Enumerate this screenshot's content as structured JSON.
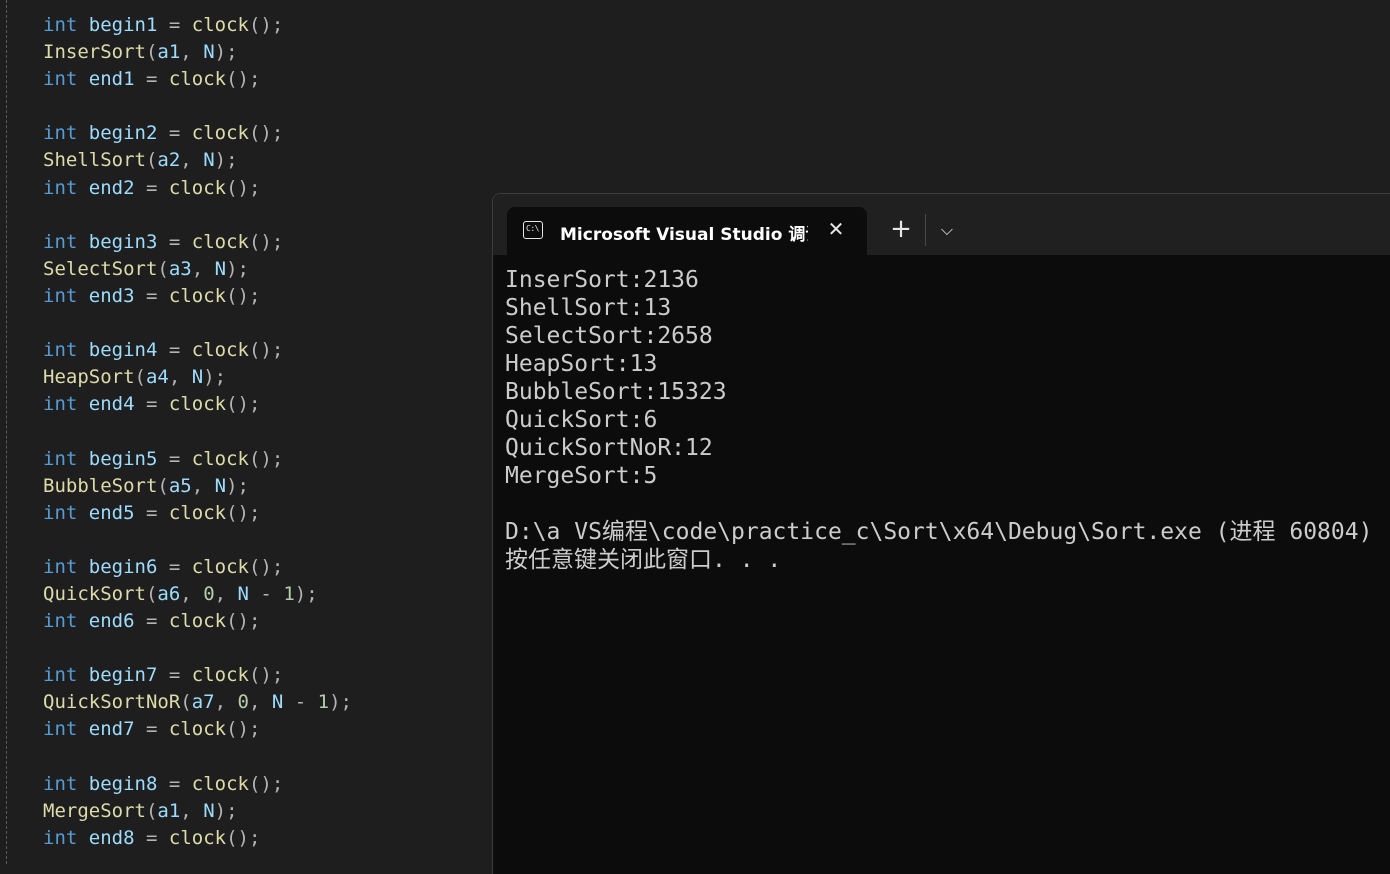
{
  "editor": {
    "lines": [
      {
        "parts": [
          [
            "kw",
            "int"
          ],
          [
            "pun",
            " "
          ],
          [
            "var",
            "begin1"
          ],
          [
            "op",
            " = "
          ],
          [
            "fn",
            "clock"
          ],
          [
            "pun",
            "();"
          ]
        ]
      },
      {
        "parts": [
          [
            "fn",
            "InserSort"
          ],
          [
            "pun",
            "("
          ],
          [
            "var",
            "a1"
          ],
          [
            "pun",
            ", "
          ],
          [
            "var",
            "N"
          ],
          [
            "pun",
            ");"
          ]
        ]
      },
      {
        "parts": [
          [
            "kw",
            "int"
          ],
          [
            "pun",
            " "
          ],
          [
            "var",
            "end1"
          ],
          [
            "op",
            " = "
          ],
          [
            "fn",
            "clock"
          ],
          [
            "pun",
            "();"
          ]
        ]
      },
      {
        "parts": []
      },
      {
        "parts": [
          [
            "kw",
            "int"
          ],
          [
            "pun",
            " "
          ],
          [
            "var",
            "begin2"
          ],
          [
            "op",
            " = "
          ],
          [
            "fn",
            "clock"
          ],
          [
            "pun",
            "();"
          ]
        ]
      },
      {
        "parts": [
          [
            "fn",
            "ShellSort"
          ],
          [
            "pun",
            "("
          ],
          [
            "var",
            "a2"
          ],
          [
            "pun",
            ", "
          ],
          [
            "var",
            "N"
          ],
          [
            "pun",
            ");"
          ]
        ]
      },
      {
        "parts": [
          [
            "kw",
            "int"
          ],
          [
            "pun",
            " "
          ],
          [
            "var",
            "end2"
          ],
          [
            "op",
            " = "
          ],
          [
            "fn",
            "clock"
          ],
          [
            "pun",
            "();"
          ]
        ]
      },
      {
        "parts": []
      },
      {
        "parts": [
          [
            "kw",
            "int"
          ],
          [
            "pun",
            " "
          ],
          [
            "var",
            "begin3"
          ],
          [
            "op",
            " = "
          ],
          [
            "fn",
            "clock"
          ],
          [
            "pun",
            "();"
          ]
        ]
      },
      {
        "parts": [
          [
            "fn",
            "SelectSort"
          ],
          [
            "pun",
            "("
          ],
          [
            "var",
            "a3"
          ],
          [
            "pun",
            ", "
          ],
          [
            "var",
            "N"
          ],
          [
            "pun",
            ");"
          ]
        ]
      },
      {
        "parts": [
          [
            "kw",
            "int"
          ],
          [
            "pun",
            " "
          ],
          [
            "var",
            "end3"
          ],
          [
            "op",
            " = "
          ],
          [
            "fn",
            "clock"
          ],
          [
            "pun",
            "();"
          ]
        ]
      },
      {
        "parts": []
      },
      {
        "parts": [
          [
            "kw",
            "int"
          ],
          [
            "pun",
            " "
          ],
          [
            "var",
            "begin4"
          ],
          [
            "op",
            " = "
          ],
          [
            "fn",
            "clock"
          ],
          [
            "pun",
            "();"
          ]
        ]
      },
      {
        "parts": [
          [
            "fn",
            "HeapSort"
          ],
          [
            "pun",
            "("
          ],
          [
            "var",
            "a4"
          ],
          [
            "pun",
            ", "
          ],
          [
            "var",
            "N"
          ],
          [
            "pun",
            ");"
          ]
        ]
      },
      {
        "parts": [
          [
            "kw",
            "int"
          ],
          [
            "pun",
            " "
          ],
          [
            "var",
            "end4"
          ],
          [
            "op",
            " = "
          ],
          [
            "fn",
            "clock"
          ],
          [
            "pun",
            "();"
          ]
        ]
      },
      {
        "parts": []
      },
      {
        "parts": [
          [
            "kw",
            "int"
          ],
          [
            "pun",
            " "
          ],
          [
            "var",
            "begin5"
          ],
          [
            "op",
            " = "
          ],
          [
            "fn",
            "clock"
          ],
          [
            "pun",
            "();"
          ]
        ]
      },
      {
        "parts": [
          [
            "fn",
            "BubbleSort"
          ],
          [
            "pun",
            "("
          ],
          [
            "var",
            "a5"
          ],
          [
            "pun",
            ", "
          ],
          [
            "var",
            "N"
          ],
          [
            "pun",
            ");"
          ]
        ]
      },
      {
        "parts": [
          [
            "kw",
            "int"
          ],
          [
            "pun",
            " "
          ],
          [
            "var",
            "end5"
          ],
          [
            "op",
            " = "
          ],
          [
            "fn",
            "clock"
          ],
          [
            "pun",
            "();"
          ]
        ]
      },
      {
        "parts": []
      },
      {
        "parts": [
          [
            "kw",
            "int"
          ],
          [
            "pun",
            " "
          ],
          [
            "var",
            "begin6"
          ],
          [
            "op",
            " = "
          ],
          [
            "fn",
            "clock"
          ],
          [
            "pun",
            "();"
          ]
        ]
      },
      {
        "parts": [
          [
            "fn",
            "QuickSort"
          ],
          [
            "pun",
            "("
          ],
          [
            "var",
            "a6"
          ],
          [
            "pun",
            ", "
          ],
          [
            "num",
            "0"
          ],
          [
            "pun",
            ", "
          ],
          [
            "var",
            "N"
          ],
          [
            "op",
            " - "
          ],
          [
            "num",
            "1"
          ],
          [
            "pun",
            ");"
          ]
        ]
      },
      {
        "parts": [
          [
            "kw",
            "int"
          ],
          [
            "pun",
            " "
          ],
          [
            "var",
            "end6"
          ],
          [
            "op",
            " = "
          ],
          [
            "fn",
            "clock"
          ],
          [
            "pun",
            "();"
          ]
        ]
      },
      {
        "parts": []
      },
      {
        "parts": [
          [
            "kw",
            "int"
          ],
          [
            "pun",
            " "
          ],
          [
            "var",
            "begin7"
          ],
          [
            "op",
            " = "
          ],
          [
            "fn",
            "clock"
          ],
          [
            "pun",
            "();"
          ]
        ]
      },
      {
        "parts": [
          [
            "fn",
            "QuickSortNoR"
          ],
          [
            "pun",
            "("
          ],
          [
            "var",
            "a7"
          ],
          [
            "pun",
            ", "
          ],
          [
            "num",
            "0"
          ],
          [
            "pun",
            ", "
          ],
          [
            "var",
            "N"
          ],
          [
            "op",
            " - "
          ],
          [
            "num",
            "1"
          ],
          [
            "pun",
            ");"
          ]
        ]
      },
      {
        "parts": [
          [
            "kw",
            "int"
          ],
          [
            "pun",
            " "
          ],
          [
            "var",
            "end7"
          ],
          [
            "op",
            " = "
          ],
          [
            "fn",
            "clock"
          ],
          [
            "pun",
            "();"
          ]
        ]
      },
      {
        "parts": []
      },
      {
        "parts": [
          [
            "kw",
            "int"
          ],
          [
            "pun",
            " "
          ],
          [
            "var",
            "begin8"
          ],
          [
            "op",
            " = "
          ],
          [
            "fn",
            "clock"
          ],
          [
            "pun",
            "();"
          ]
        ]
      },
      {
        "parts": [
          [
            "fn",
            "MergeSort"
          ],
          [
            "pun",
            "("
          ],
          [
            "var",
            "a1"
          ],
          [
            "pun",
            ", "
          ],
          [
            "var",
            "N"
          ],
          [
            "pun",
            ");"
          ]
        ]
      },
      {
        "parts": [
          [
            "kw",
            "int"
          ],
          [
            "pun",
            " "
          ],
          [
            "var",
            "end8"
          ],
          [
            "op",
            " = "
          ],
          [
            "fn",
            "clock"
          ],
          [
            "pun",
            "();"
          ]
        ]
      }
    ]
  },
  "terminal": {
    "tab_title": "Microsoft Visual Studio 调试控制台",
    "close_glyph": "✕",
    "new_tab_glyph": "+",
    "dropdown_glyph": "⌵",
    "output": [
      "InserSort:2136",
      "ShellSort:13",
      "SelectSort:2658",
      "HeapSort:13",
      "BubbleSort:15323",
      "QuickSort:6",
      "QuickSortNoR:12",
      "MergeSort:5",
      "",
      "D:\\a VS编程\\code\\practice_c\\Sort\\x64\\Debug\\Sort.exe (进程 60804)",
      "按任意键关闭此窗口. . ."
    ]
  }
}
